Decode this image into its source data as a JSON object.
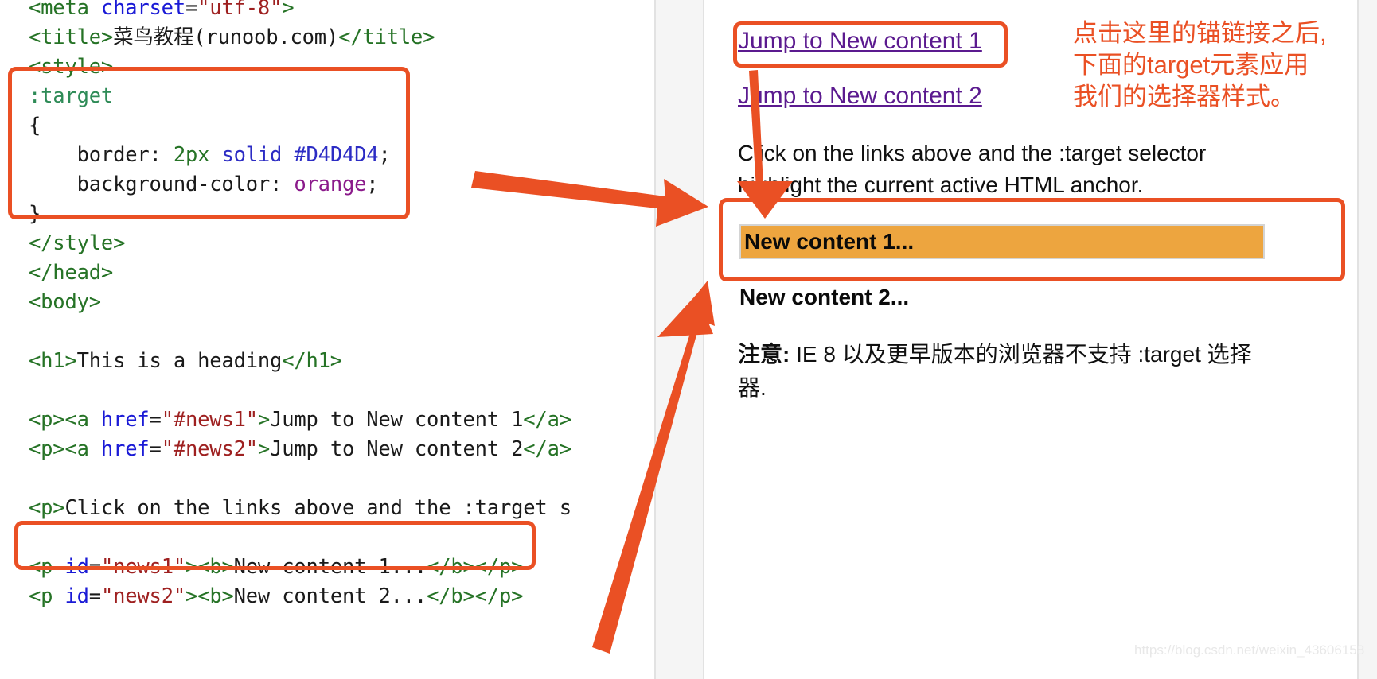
{
  "code_pane": {
    "language": "html",
    "lines": [
      [
        {
          "t": "<meta ",
          "c": "tag"
        },
        {
          "t": "charset",
          "c": "attr"
        },
        {
          "t": "=",
          "c": "plain"
        },
        {
          "t": "\"utf-8\"",
          "c": "val"
        },
        {
          "t": ">",
          "c": "tag"
        }
      ],
      [
        {
          "t": "<title>",
          "c": "tag"
        },
        {
          "t": "菜鸟教程(runoob.com)",
          "c": "plain"
        },
        {
          "t": "</title>",
          "c": "tag"
        }
      ],
      [
        {
          "t": "<style>",
          "c": "tag"
        }
      ],
      [
        {
          "t": ":target",
          "c": "sel"
        }
      ],
      [
        {
          "t": "{",
          "c": "punc"
        }
      ],
      [
        {
          "t": "    border: ",
          "c": "prop"
        },
        {
          "t": "2px",
          "c": "num"
        },
        {
          "t": " ",
          "c": "plain"
        },
        {
          "t": "solid",
          "c": "kw"
        },
        {
          "t": " ",
          "c": "plain"
        },
        {
          "t": "#D4D4D4",
          "c": "hexv"
        },
        {
          "t": ";",
          "c": "punc"
        }
      ],
      [
        {
          "t": "    background-color: ",
          "c": "prop"
        },
        {
          "t": "orange",
          "c": "orangev"
        },
        {
          "t": ";",
          "c": "punc"
        }
      ],
      [
        {
          "t": "}",
          "c": "punc"
        }
      ],
      [
        {
          "t": "</style>",
          "c": "tag"
        }
      ],
      [
        {
          "t": "</head>",
          "c": "tag"
        }
      ],
      [
        {
          "t": "<body>",
          "c": "tag"
        }
      ],
      [],
      [
        {
          "t": "<h1>",
          "c": "tag"
        },
        {
          "t": "This is a heading",
          "c": "plain"
        },
        {
          "t": "</h1>",
          "c": "tag"
        }
      ],
      [],
      [
        {
          "t": "<p><a ",
          "c": "tag"
        },
        {
          "t": "href",
          "c": "attr"
        },
        {
          "t": "=",
          "c": "plain"
        },
        {
          "t": "\"#news1\"",
          "c": "val"
        },
        {
          "t": ">",
          "c": "tag"
        },
        {
          "t": "Jump to New content 1",
          "c": "plain"
        },
        {
          "t": "</a>",
          "c": "tag"
        }
      ],
      [
        {
          "t": "<p><a ",
          "c": "tag"
        },
        {
          "t": "href",
          "c": "attr"
        },
        {
          "t": "=",
          "c": "plain"
        },
        {
          "t": "\"#news2\"",
          "c": "val"
        },
        {
          "t": ">",
          "c": "tag"
        },
        {
          "t": "Jump to New content 2",
          "c": "plain"
        },
        {
          "t": "</a>",
          "c": "tag"
        }
      ],
      [],
      [
        {
          "t": "<p>",
          "c": "tag"
        },
        {
          "t": "Click on the links above and the :target s",
          "c": "plain"
        }
      ],
      [],
      [
        {
          "t": "<p ",
          "c": "tag"
        },
        {
          "t": "id",
          "c": "attr"
        },
        {
          "t": "=",
          "c": "plain"
        },
        {
          "t": "\"news1\"",
          "c": "val"
        },
        {
          "t": "><b>",
          "c": "tag"
        },
        {
          "t": "New content 1...",
          "c": "plain"
        },
        {
          "t": "</b></p>",
          "c": "tag"
        }
      ],
      [
        {
          "t": "<p ",
          "c": "tag"
        },
        {
          "t": "id",
          "c": "attr"
        },
        {
          "t": "=",
          "c": "plain"
        },
        {
          "t": "\"news2\"",
          "c": "val"
        },
        {
          "t": "><b>",
          "c": "tag"
        },
        {
          "t": "New content 2...",
          "c": "plain"
        },
        {
          "t": "</b></p>",
          "c": "tag"
        }
      ]
    ]
  },
  "preview": {
    "link1": "Jump to New content 1",
    "link2": "Jump to New content 2",
    "description": "Click on the links above and the :target selector highlight the current active HTML anchor.",
    "news1": "New content 1...",
    "news2": "New content 2...",
    "note_label": "注意:",
    "note_text": " IE 8 以及更早版本的浏览器不支持 :target 选择器."
  },
  "annotation": {
    "text": "点击这里的锚链接之后,\n下面的target元素应用\n我们的选择器样式。",
    "color": "#ea5024"
  },
  "colors": {
    "annotation_orange": "#ea5024",
    "target_background": "#eda53f",
    "target_border": "#d4d4d4",
    "link_purple": "#5b1a8f",
    "code_tag_green": "#267326",
    "code_attr_blue": "#1a1ad6",
    "code_value_red": "#9e2020",
    "gutter_gray": "#f5f5f5"
  },
  "watermark": "https://blog.csdn.net/weixin_43606158"
}
